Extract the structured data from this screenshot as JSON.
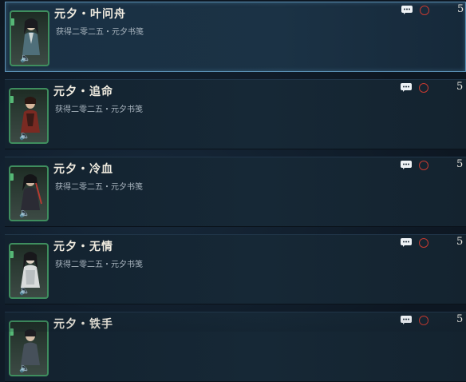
{
  "items": [
    {
      "title": "元夕・叶问舟",
      "subtitle": "获得二零二五・元夕书笺",
      "count": "5",
      "selected": true,
      "card_icon": "character-portrait",
      "audio_icon": "speaker-icon"
    },
    {
      "title": "元夕・追命",
      "subtitle": "获得二零二五・元夕书笺",
      "count": "5",
      "selected": false,
      "card_icon": "character-portrait",
      "audio_icon": "speaker-icon"
    },
    {
      "title": "元夕・冷血",
      "subtitle": "获得二零二五・元夕书笺",
      "count": "5",
      "selected": false,
      "card_icon": "character-portrait",
      "audio_icon": "speaker-icon"
    },
    {
      "title": "元夕・无情",
      "subtitle": "获得二零二五・元夕书笺",
      "count": "5",
      "selected": false,
      "card_icon": "character-portrait",
      "audio_icon": "speaker-icon"
    },
    {
      "title": "元夕・铁手",
      "subtitle": "",
      "count": "5",
      "selected": false,
      "card_icon": "character-portrait",
      "audio_icon": "speaker-icon"
    }
  ],
  "colors": {
    "card_border": "#3f8e5e",
    "status_ring": "#c53a30",
    "selected_border": "#5a8fb3"
  }
}
